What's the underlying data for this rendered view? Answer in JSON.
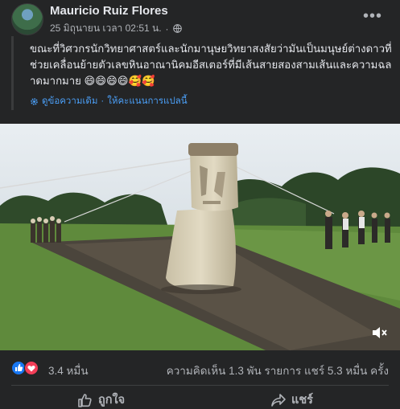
{
  "post": {
    "author": "Mauricio Ruiz Flores",
    "timestamp": "25 มิถุนายน เวลา 02:51 น.",
    "separator": "·",
    "more_icon": "more-horizontal-icon",
    "text": "ขณะที่วิศวกรนักวิทยาศาสตร์และนักมานุษยวิทยาสงสัยว่ามันเป็นมนุษย์ต่างดาวที่ช่วยเคลื่อนย้ายตัวเลขหินอาณานิคมอีสเตอร์ที่มีเส้นสายสองสามเส้นและความฉลาดมากมาย 😄😄😄😄🥰🥰",
    "see_original": "ดูข้อความเดิม",
    "rate_translation": "ให้คะแนนการแปลนี้",
    "link_separator": "·"
  },
  "stats": {
    "reactions_count": "3.4 หมื่น",
    "comments_shares": "ความคิดเห็น 1.3 พัน รายการ  แชร์ 5.3 หมื่น ครั้ง"
  },
  "actions": {
    "like_label": "ถูกใจ",
    "share_label": "แชร์"
  },
  "colors": {
    "background": "#242526",
    "text_primary": "#e4e6eb",
    "text_secondary": "#b0b3b8",
    "link": "#4b9ef5",
    "like_blue": "#1877f2",
    "love_red": "#f33e58"
  }
}
